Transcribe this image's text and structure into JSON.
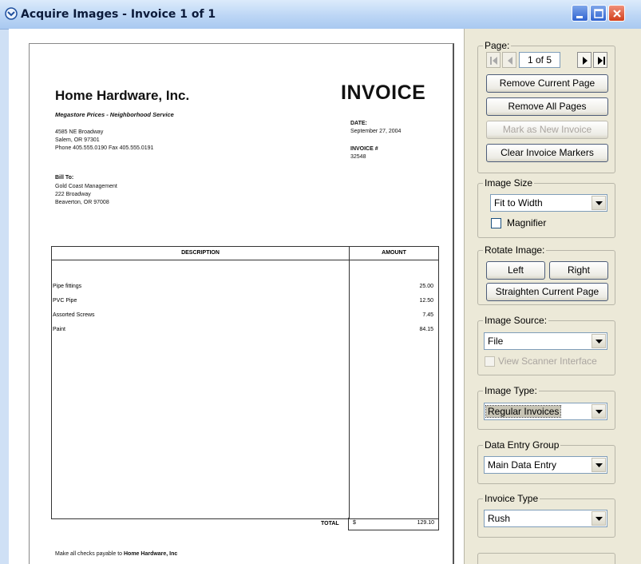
{
  "window": {
    "title": "Acquire Images - Invoice 1 of 1"
  },
  "document": {
    "company_name": "Home Hardware, Inc.",
    "tagline": "Megastore Prices - Neighborhood Service",
    "address_line1": "4585 NE Broadway",
    "address_line2": "Salem, OR 97301",
    "address_line3": "Phone 405.555.0190   Fax 405.555.0191",
    "invoice_title": "INVOICE",
    "date_label": "DATE:",
    "date_value": "September 27, 2004",
    "invoice_no_label": "INVOICE #",
    "invoice_no_value": "32548",
    "bill_to_label": "Bill To:",
    "bill_to_line1": "Gold Coast Management",
    "bill_to_line2": "222 Broadway",
    "bill_to_line3": "Beaverton, OR 97008",
    "col_description": "DESCRIPTION",
    "col_amount": "AMOUNT",
    "line_items": [
      {
        "description": "Pipe fittings",
        "amount": "25.00"
      },
      {
        "description": "PVC Pipe",
        "amount": "12.50"
      },
      {
        "description": "Assorted Screws",
        "amount": "7.45"
      },
      {
        "description": "Paint",
        "amount": "84.15"
      }
    ],
    "total_label": "TOTAL",
    "total_currency": "$",
    "total_value": "129.10",
    "footer_prefix": "Make all checks payable to ",
    "footer_company": "Home Hardware, Inc"
  },
  "page_group": {
    "legend": "Page:",
    "page_indicator": "1 of 5",
    "remove_current": "Remove Current Page",
    "remove_all": "Remove All Pages",
    "mark_new": "Mark as New Invoice",
    "clear_markers": "Clear Invoice Markers"
  },
  "image_size": {
    "legend": "Image Size",
    "selected": "Fit to Width",
    "magnifier_label": "Magnifier",
    "magnifier_checked": false
  },
  "rotate": {
    "legend": "Rotate Image:",
    "left": "Left",
    "right": "Right",
    "straighten": "Straighten Current Page"
  },
  "image_source": {
    "legend": "Image Source:",
    "selected": "File",
    "scanner_label": "View Scanner Interface",
    "scanner_checked": false
  },
  "image_type": {
    "legend": "Image Type:",
    "selected": "Regular Invoices"
  },
  "data_entry": {
    "legend": "Data Entry Group",
    "selected": "Main Data Entry"
  },
  "invoice_type": {
    "legend": "Invoice Type",
    "selected": "Rush"
  },
  "icons": {
    "title_icon": "acquire-icon",
    "minimize": "minimize-icon",
    "maximize": "maximize-icon",
    "close": "close-icon"
  }
}
